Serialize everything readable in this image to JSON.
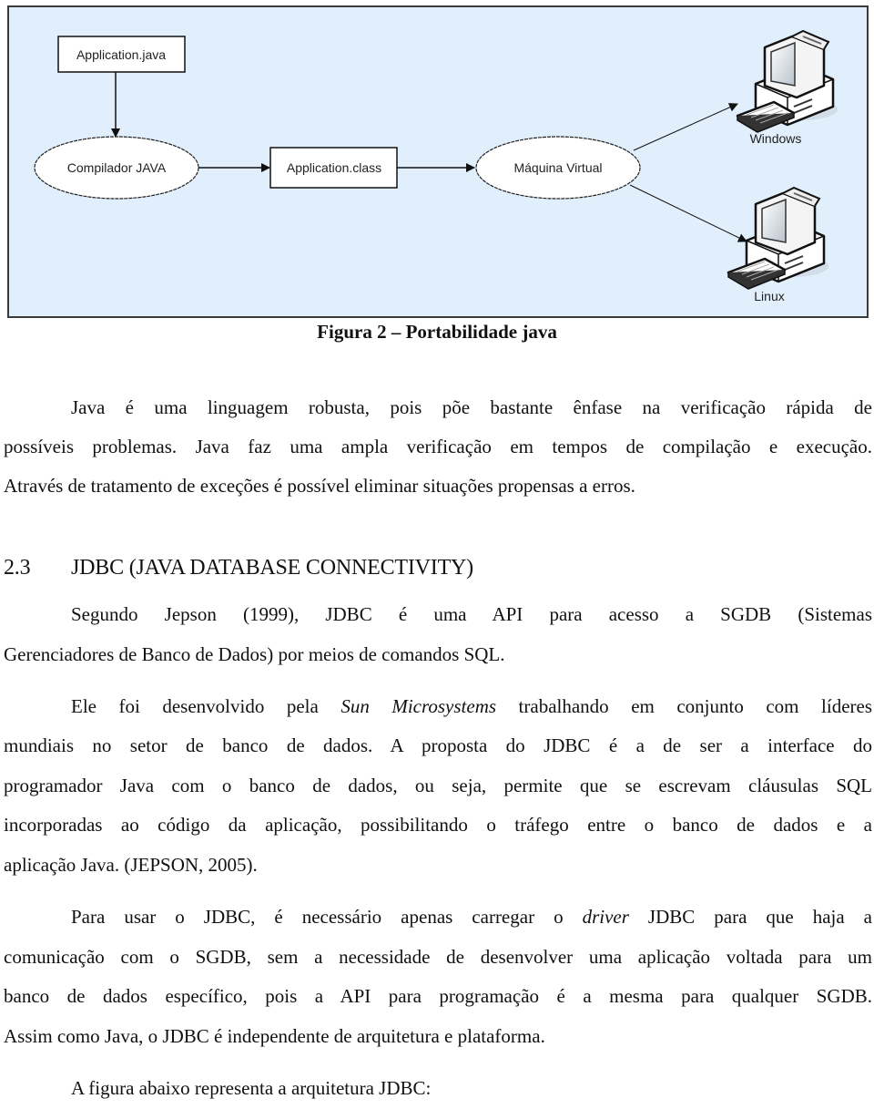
{
  "figure": {
    "nodes": {
      "source_file": "Application.java",
      "compiler": "Compilador JAVA",
      "bytecode_file": "Application.class",
      "virtual_machine": "Máquina Virtual",
      "target_windows": "Windows",
      "target_linux": "Linux"
    },
    "icons": [
      "computer-icon",
      "computer-icon"
    ],
    "colors": {
      "background": "#e1eefc",
      "border": "#3a3a3a",
      "node_fill": "#ffffff"
    },
    "caption": "Figura 2 – Portabilidade java"
  },
  "paragraph1": {
    "lines": [
      "Java é uma linguagem robusta, pois põe bastante ênfase na verificação rápida de",
      "possíveis problemas. Java faz uma ampla verificação em tempos de compilação e execução.",
      "Através de tratamento de exceções é possível eliminar situações propensas a erros."
    ]
  },
  "section": {
    "number": "2.3",
    "title": "JDBC (JAVA DATABASE CONNECTIVITY)"
  },
  "paragraph2": {
    "lines": [
      "Segundo Jepson (1999), JDBC é uma API para acesso a SGDB (Sistemas",
      "Gerenciadores de Banco de Dados) por meios de comandos SQL."
    ]
  },
  "paragraph3": {
    "line1_before": "Ele foi desenvolvido pela ",
    "line1_italic": "Sun Microsystems",
    "line1_after": " trabalhando em conjunto com líderes",
    "lines": [
      "mundiais no setor de banco de dados. A proposta do JDBC é a de ser a interface do",
      "programador Java com o banco de dados, ou seja, permite que se escrevam cláusulas SQL",
      "incorporadas ao código da aplicação, possibilitando o tráfego entre o banco de dados e a",
      "aplicação Java. (JEPSON, 2005)."
    ]
  },
  "paragraph4": {
    "line1_before": "Para usar o JDBC, é necessário apenas carregar o ",
    "line1_italic": "driver",
    "line1_after": " JDBC para que haja a",
    "lines": [
      "comunicação com o SGDB, sem a necessidade de desenvolver uma aplicação voltada para um",
      "banco de dados específico, pois a API para programação é a mesma para qualquer SGDB.",
      "Assim como Java, o JDBC é independente de arquitetura e plataforma."
    ]
  },
  "paragraph5": {
    "text": "A figura abaixo representa a arquitetura JDBC:"
  }
}
